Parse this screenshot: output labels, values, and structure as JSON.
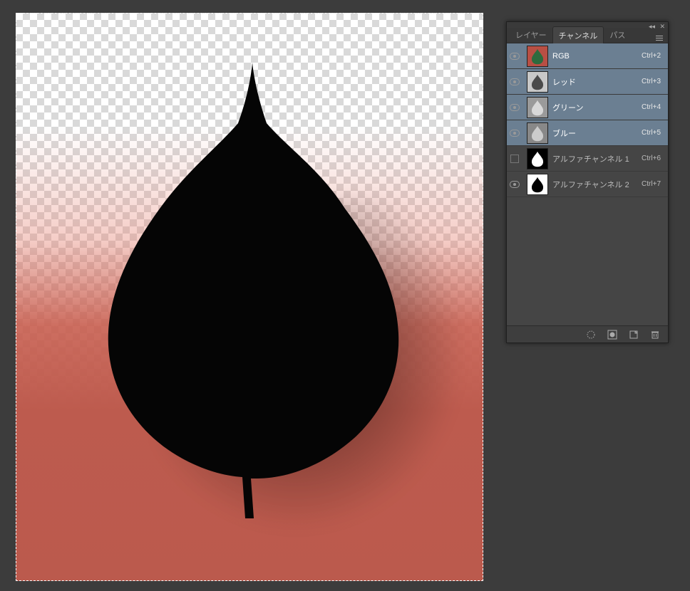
{
  "panel": {
    "tabs": [
      {
        "label": "レイヤー",
        "active": false
      },
      {
        "label": "チャンネル",
        "active": true
      },
      {
        "label": "パス",
        "active": false
      }
    ],
    "channels": [
      {
        "name": "RGB",
        "shortcut": "Ctrl+2",
        "visible": true,
        "selected": true,
        "thumb": "rgb"
      },
      {
        "name": "レッド",
        "shortcut": "Ctrl+3",
        "visible": true,
        "selected": true,
        "thumb": "gray1"
      },
      {
        "name": "グリーン",
        "shortcut": "Ctrl+4",
        "visible": true,
        "selected": true,
        "thumb": "gray2"
      },
      {
        "name": "ブルー",
        "shortcut": "Ctrl+5",
        "visible": true,
        "selected": true,
        "thumb": "gray3"
      },
      {
        "name": "アルファチャンネル 1",
        "shortcut": "Ctrl+6",
        "visible": false,
        "selected": false,
        "thumb": "alpha1"
      },
      {
        "name": "アルファチャンネル 2",
        "shortcut": "Ctrl+7",
        "visible": true,
        "selected": false,
        "thumb": "alpha2"
      }
    ],
    "footer_icons": [
      "selection-to-channel-icon",
      "mask-icon",
      "new-channel-icon",
      "trash-icon"
    ]
  }
}
